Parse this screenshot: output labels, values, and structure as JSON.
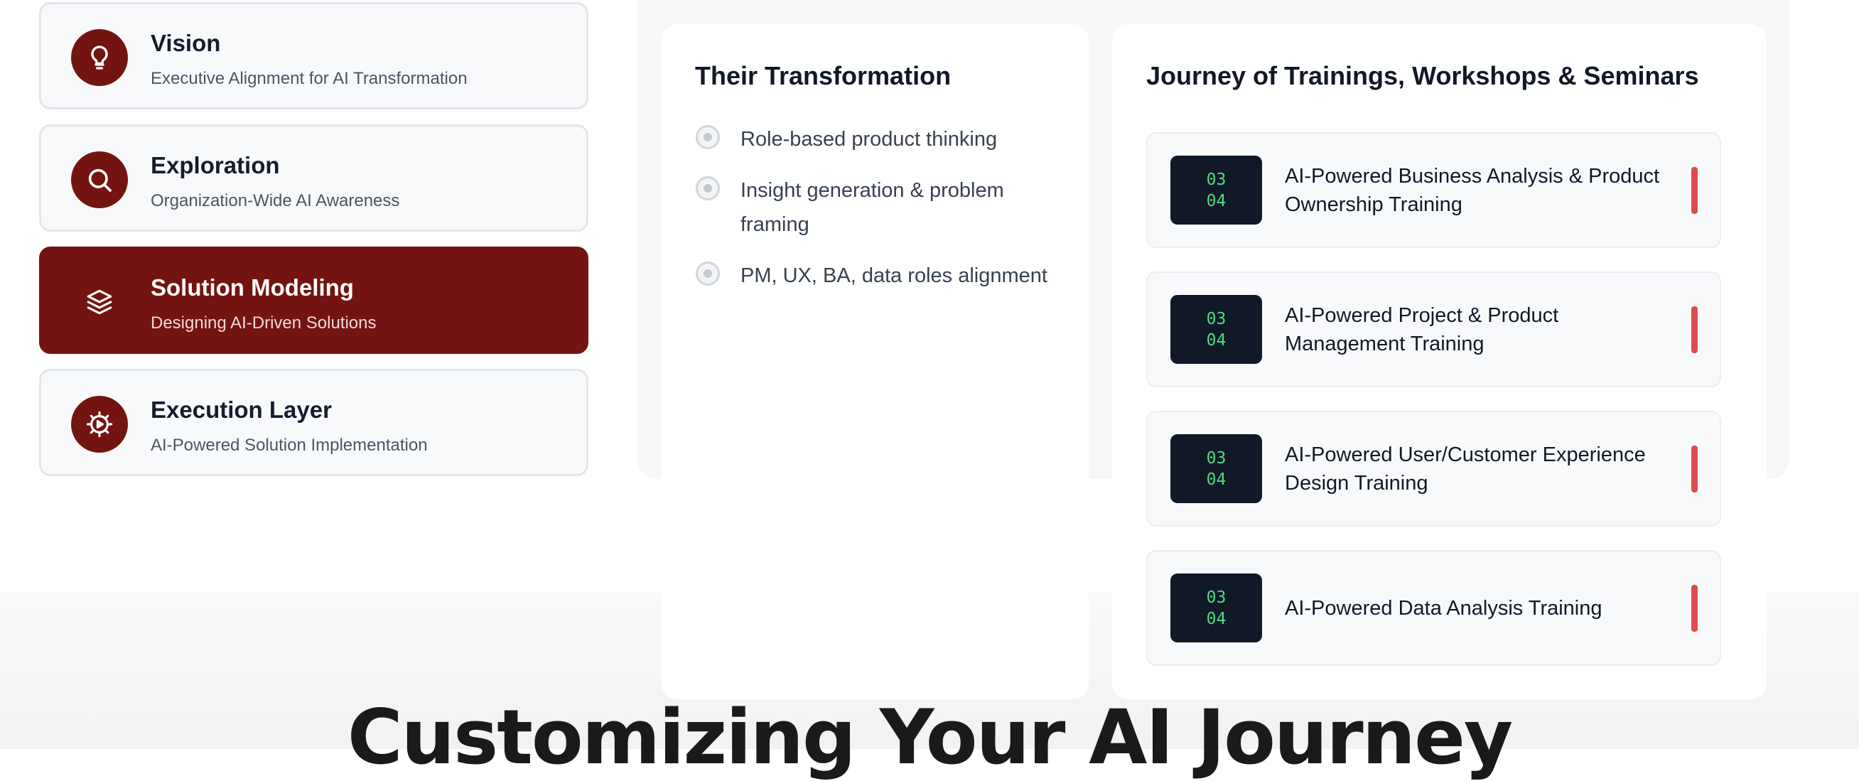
{
  "stages": [
    {
      "title": "Vision",
      "subtitle": "Executive Alignment for AI Transformation",
      "icon": "lightbulb-icon"
    },
    {
      "title": "Exploration",
      "subtitle": "Organization-Wide AI Awareness",
      "icon": "search-icon"
    },
    {
      "title": "Solution Modeling",
      "subtitle": "Designing AI-Driven Solutions",
      "icon": "layers-icon",
      "active": true
    },
    {
      "title": "Execution Layer",
      "subtitle": "AI-Powered Solution Implementation",
      "icon": "gear-icon"
    }
  ],
  "transformation": {
    "title": "Their Transformation",
    "items": [
      "Role-based product thinking",
      "Insight generation & problem framing",
      "PM, UX, BA, data roles alignment"
    ]
  },
  "journey": {
    "title": "Journey of Trainings, Workshops & Seminars",
    "sessions": [
      {
        "date_top": "03",
        "date_bottom": "04",
        "name": "AI-Powered Business Analysis & Product Ownership Training"
      },
      {
        "date_top": "03",
        "date_bottom": "04",
        "name": "AI-Powered Project & Product Management Training"
      },
      {
        "date_top": "03",
        "date_bottom": "04",
        "name": "AI-Powered User/Customer Experience Design Training"
      },
      {
        "date_top": "03",
        "date_bottom": "04",
        "name": "AI-Powered Data Analysis Training"
      }
    ]
  },
  "section_heading": "Customizing Your AI Journey",
  "colors": {
    "brand": "#731410",
    "accent_marker": "#dc4c4c",
    "date_badge_bg": "#111827",
    "date_badge_text": "#4ade80"
  }
}
